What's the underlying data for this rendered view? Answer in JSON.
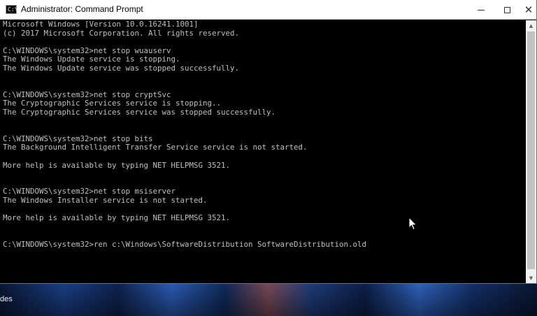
{
  "window": {
    "title": "Administrator: Command Prompt",
    "controls": {
      "minimize_icon": "minimize-icon",
      "maximize_icon": "maximize-icon",
      "close_icon": "close-icon"
    }
  },
  "console": {
    "lines": [
      "Microsoft Windows [Version 10.0.16241.1001]",
      "(c) 2017 Microsoft Corporation. All rights reserved.",
      "",
      "C:\\WINDOWS\\system32>net stop wuauserv",
      "The Windows Update service is stopping.",
      "The Windows Update service was stopped successfully.",
      "",
      "",
      "C:\\WINDOWS\\system32>net stop cryptSvc",
      "The Cryptographic Services service is stopping..",
      "The Cryptographic Services service was stopped successfully.",
      "",
      "",
      "C:\\WINDOWS\\system32>net stop bits",
      "The Background Intelligent Transfer Service service is not started.",
      "",
      "More help is available by typing NET HELPMSG 3521.",
      "",
      "",
      "C:\\WINDOWS\\system32>net stop msiserver",
      "The Windows Installer service is not started.",
      "",
      "More help is available by typing NET HELPMSG 3521.",
      "",
      "",
      "C:\\WINDOWS\\system32>ren c:\\Windows\\SoftwareDistribution SoftwareDistribution.old"
    ]
  },
  "desktop": {
    "partial_label": "des"
  },
  "colors": {
    "console_bg": "#000000",
    "console_text": "#c0c0c0",
    "titlebar_bg": "#ffffff"
  }
}
